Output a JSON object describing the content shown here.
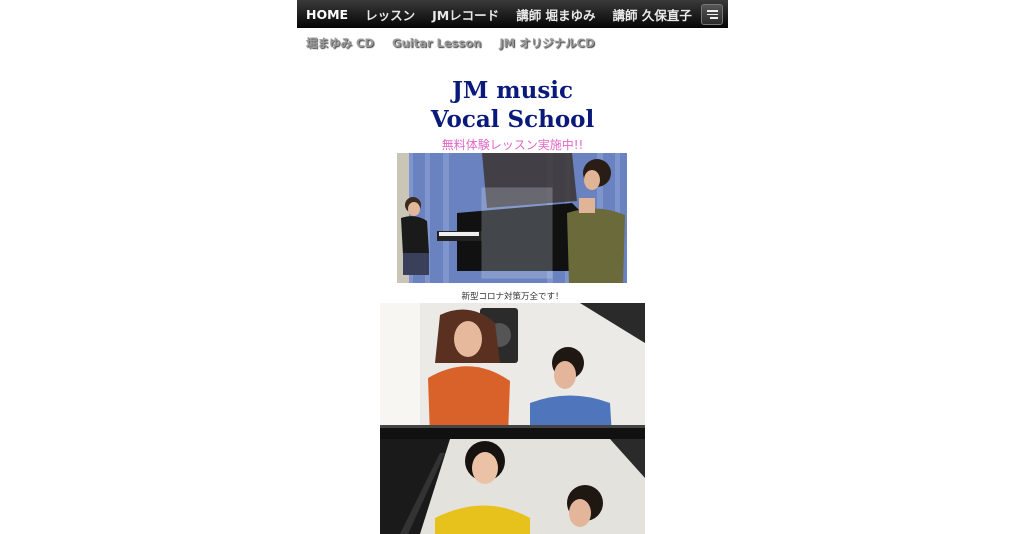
{
  "nav": {
    "items": [
      "HOME",
      "レッスン",
      "JMレコード",
      "講師 堀まゆみ",
      "講師 久保直子"
    ],
    "menu_icon": "menu-icon"
  },
  "subnav": {
    "items": [
      "堀まゆみ CD",
      "Guitar Lesson",
      "JM オリジナルCD"
    ]
  },
  "header": {
    "title_line1": "JM music",
    "title_line2": "Vocal School",
    "promo": "無料体験レッスン実施中!!"
  },
  "content": {
    "caption": "新型コロナ対策万全です！"
  },
  "colors": {
    "title": "#0a1a7a",
    "promo": "#e266c6",
    "navbar": "#111111"
  }
}
